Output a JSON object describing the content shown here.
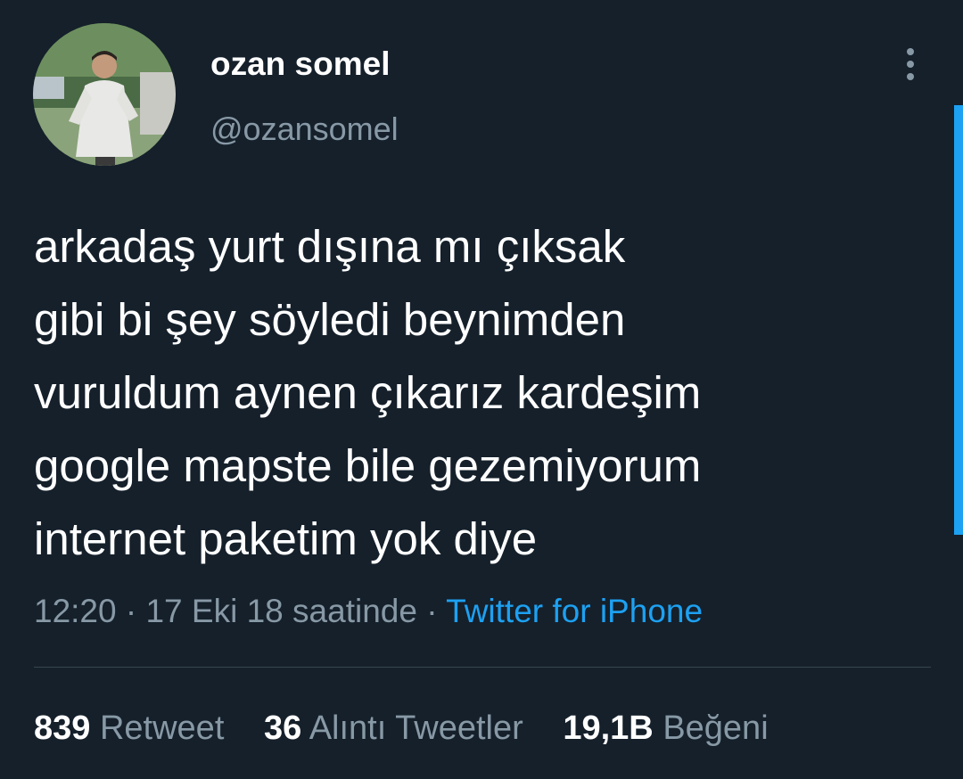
{
  "user": {
    "display_name": "ozan somel",
    "handle": "@ozansomel"
  },
  "tweet": {
    "lines": [
      "arkadaş yurt dışına mı çıksak",
      "gibi bi şey söyledi beynimden",
      "vuruldum aynen çıkarız kardeşim",
      "google mapste bile gezemiyorum",
      "internet paketim yok diye"
    ],
    "time": "12:20",
    "separator": " · ",
    "date": "17 Eki 18 saatinde",
    "source": "Twitter for iPhone"
  },
  "stats": {
    "retweets": {
      "count": "839",
      "label": "Retweet"
    },
    "quotes": {
      "count": "36",
      "label": "Alıntı Tweetler"
    },
    "likes": {
      "count": "19,1B",
      "label": "Beğeni"
    }
  },
  "colors": {
    "background": "#15202b",
    "secondary_text": "#8899a6",
    "accent": "#1da1f2",
    "divider": "#38444d"
  },
  "icons": {
    "more": "more-vertical-icon"
  }
}
